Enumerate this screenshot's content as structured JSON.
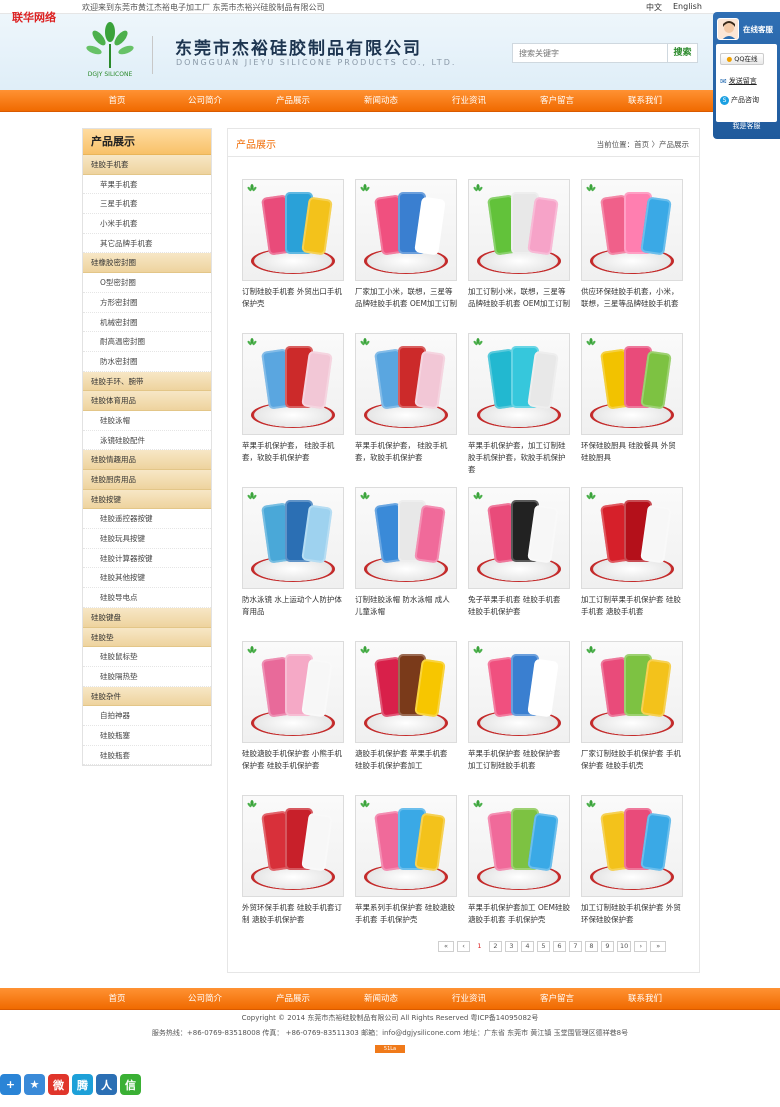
{
  "corner_brand": "联华网络",
  "topbar": {
    "welcome": "欢迎来到东莞市黄江杰裕电子加工厂  东莞市杰裕兴硅胶制品有限公司",
    "lang_cn": "中文",
    "lang_en": "English"
  },
  "header": {
    "logo_caption": "DGJY SILICONE",
    "company_cn": "东莞市杰裕硅胶制品有限公司",
    "company_en": "DONGGUAN JIEYU SILICONE PRODUCTS CO., LTD.",
    "search_placeholder": "搜索关键字",
    "search_button": "搜索"
  },
  "nav": [
    "首页",
    "公司简介",
    "产品展示",
    "新闻动态",
    "行业资讯",
    "客户留言",
    "联系我们"
  ],
  "sidebar": {
    "title": "产品展示",
    "items": [
      {
        "type": "cat",
        "label": "硅胶手机套"
      },
      {
        "type": "sub",
        "label": "苹果手机套"
      },
      {
        "type": "sub",
        "label": "三星手机套"
      },
      {
        "type": "sub",
        "label": "小米手机套"
      },
      {
        "type": "sub",
        "label": "其它品牌手机套"
      },
      {
        "type": "cat",
        "label": "硅橡胶密封圈"
      },
      {
        "type": "sub",
        "label": "O型密封圈"
      },
      {
        "type": "sub",
        "label": "方形密封圈"
      },
      {
        "type": "sub",
        "label": "机械密封圈"
      },
      {
        "type": "sub",
        "label": "耐高温密封圈"
      },
      {
        "type": "sub",
        "label": "防水密封圈"
      },
      {
        "type": "cat",
        "label": "硅胶手环、腕带"
      },
      {
        "type": "cat",
        "label": "硅胶体育用品"
      },
      {
        "type": "sub",
        "label": "硅胶泳帽"
      },
      {
        "type": "sub",
        "label": "泳镜硅胶配件"
      },
      {
        "type": "cat",
        "label": "硅胶情趣用品"
      },
      {
        "type": "cat",
        "label": "硅胶厨房用品"
      },
      {
        "type": "cat",
        "label": "硅胶按键"
      },
      {
        "type": "sub",
        "label": "硅胶遥控器按键"
      },
      {
        "type": "sub",
        "label": "硅胶玩具按键"
      },
      {
        "type": "sub",
        "label": "硅胶计算器按键"
      },
      {
        "type": "sub",
        "label": "硅胶其他按键"
      },
      {
        "type": "sub",
        "label": "硅胶导电点"
      },
      {
        "type": "cat",
        "label": "硅胶键盘"
      },
      {
        "type": "cat",
        "label": "硅胶垫"
      },
      {
        "type": "sub",
        "label": "硅胶鼠标垫"
      },
      {
        "type": "sub",
        "label": "硅胶隔热垫"
      },
      {
        "type": "cat",
        "label": "硅胶杂件"
      },
      {
        "type": "sub",
        "label": "自拍神器"
      },
      {
        "type": "sub",
        "label": "硅胶瓶塞"
      },
      {
        "type": "sub",
        "label": "硅胶瓶套"
      }
    ]
  },
  "main": {
    "title": "产品展示",
    "breadcrumb": "当前位置：首页 〉产品展示"
  },
  "products": [
    {
      "caption": "订制硅胶手机套 外贸出口手机保护壳",
      "colors": [
        "#e94b7a",
        "#2aa1d8",
        "#f3c21b"
      ]
    },
    {
      "caption": "厂家加工小米，联想，三星等品牌硅胶手机套 OEM加工订制",
      "colors": [
        "#f0507f",
        "#3a7fd0",
        "#ffffff"
      ]
    },
    {
      "caption": "加工订制小米，联想，三星等品牌硅胶手机套 OEM加工订制",
      "colors": [
        "#62c23a",
        "#e8e8e8",
        "#f6a3c8"
      ]
    },
    {
      "caption": "供应环保硅胶手机套，小米，联想，三星等品牌硅胶手机套",
      "colors": [
        "#f0608a",
        "#ff7fb0",
        "#3aa9e6"
      ]
    },
    {
      "caption": "苹果手机保护套， 硅胶手机套，软胶手机保护套",
      "colors": [
        "#5aa6e0",
        "#cc2a2a",
        "#f2c7d6"
      ]
    },
    {
      "caption": "苹果手机保护套， 硅胶手机套，软胶手机保护套",
      "colors": [
        "#5aa6e0",
        "#cc2a2a",
        "#f2c7d6"
      ]
    },
    {
      "caption": "苹果手机保护套，加工订制硅胶手机保护套，软胶手机保护套",
      "colors": [
        "#22b8d0",
        "#36c7dc",
        "#e8e8e8"
      ]
    },
    {
      "caption": "环保硅胶厨具 硅胶餐具 外贸硅胶厨具",
      "colors": [
        "#f2c200",
        "#e94b7a",
        "#7dc242"
      ]
    },
    {
      "caption": "防水泳镜 水上运动个人防护体育用品",
      "colors": [
        "#4aa8d8",
        "#2b6fb4",
        "#9ed2ef"
      ]
    },
    {
      "caption": "订制硅胶泳帽 防水泳帽 成人儿童泳帽",
      "colors": [
        "#3a8ad8",
        "#e8e8e8",
        "#f06a9a"
      ]
    },
    {
      "caption": "兔子苹果手机套 硅胶手机套 硅胶手机保护套",
      "colors": [
        "#e94b7a",
        "#222222",
        "#f7f7f7"
      ]
    },
    {
      "caption": "加工订制苹果手机保护套 硅胶手机套 溏胶手机套",
      "colors": [
        "#d6202a",
        "#b4101a",
        "#f7f7f7"
      ]
    },
    {
      "caption": "硅胶溏胶手机保护套 小熊手机保护套 硅胶手机保护套",
      "colors": [
        "#e86a9a",
        "#f5a9c6",
        "#f7f7f7"
      ]
    },
    {
      "caption": "溏胶手机保护套 苹果手机套 硅胶手机保护套加工",
      "colors": [
        "#d8204a",
        "#7a3a1a",
        "#f7c600"
      ]
    },
    {
      "caption": "苹果手机保护套 硅胶保护套 加工订制硅胶手机套",
      "colors": [
        "#f0507f",
        "#3a7fd0",
        "#ffffff"
      ]
    },
    {
      "caption": "厂家订制硅胶手机保护套 手机保护套 硅胶手机壳",
      "colors": [
        "#e94b7a",
        "#7dc242",
        "#f3c21b"
      ]
    },
    {
      "caption": "外贸环保手机套 硅胶手机套订制 溏胶手机保护套",
      "colors": [
        "#d8303a",
        "#c8202a",
        "#f7f7f7"
      ]
    },
    {
      "caption": "苹果系列手机保护套 硅胶溏胶手机套 手机保护壳",
      "colors": [
        "#f06a9a",
        "#3aa9e6",
        "#f3c21b"
      ]
    },
    {
      "caption": "苹果手机保护套加工 OEM硅胶溏胶手机套 手机保护壳",
      "colors": [
        "#f06a9a",
        "#7dc242",
        "#3aa9e6"
      ]
    },
    {
      "caption": "加工订制硅胶手机保护套 外贸环保硅胶保护套",
      "colors": [
        "#f3c21b",
        "#e94b7a",
        "#3aa9e6"
      ]
    }
  ],
  "pagination": [
    "«",
    "‹",
    "1",
    "2",
    "3",
    "4",
    "5",
    "6",
    "7",
    "8",
    "9",
    "10",
    "›",
    "»"
  ],
  "pagination_current": "1",
  "footer": {
    "copyright": "Copyright © 2014 东莞市杰裕硅胶制品有限公司 All Rights Reserved 粤ICP备14095082号",
    "contact": "服务热线：+86-0769-83518008  传真： +86-0769-83511303 邮箱：info@dgjysilicone.com 地址：广东省 东莞市 黄江镇 玉堂围管理区德祥巷8号",
    "stat_label": "51La"
  },
  "service": {
    "title": "在线客服",
    "qq_label": "QQ在线",
    "message_label": "发送留言",
    "consult_label": "产品咨询",
    "bottom_label": "我是客服"
  },
  "share": [
    {
      "icon": "share-plus-icon",
      "color": "#2a84d6",
      "glyph": "+"
    },
    {
      "icon": "favorite-star-icon",
      "color": "#3a8ad8",
      "glyph": "★"
    },
    {
      "icon": "weibo-icon",
      "color": "#e0352b",
      "glyph": "微"
    },
    {
      "icon": "tencent-weibo-icon",
      "color": "#1da0d8",
      "glyph": "腾"
    },
    {
      "icon": "renren-icon",
      "color": "#2b6fb4",
      "glyph": "人"
    },
    {
      "icon": "wechat-icon",
      "color": "#3ab034",
      "glyph": "信"
    }
  ],
  "colors": {
    "nav_orange": "#f06a00",
    "accent_red": "#d22222",
    "brand_blue": "#1f5a9c",
    "brand_green": "#2b8a2b"
  }
}
